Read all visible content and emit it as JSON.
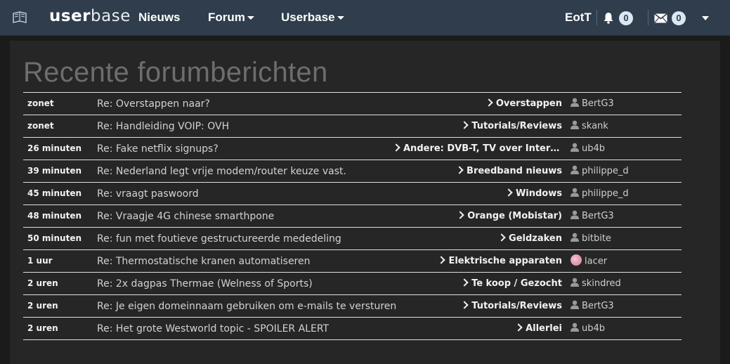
{
  "nav": {
    "brand_bold": "user",
    "brand_light": "base",
    "items": [
      {
        "label": "Nieuws",
        "dropdown": false
      },
      {
        "label": "Forum",
        "dropdown": true
      },
      {
        "label": "Userbase",
        "dropdown": true
      }
    ],
    "username": "EotT",
    "notifications_count": "0",
    "messages_count": "0",
    "icons": [
      "book-icon",
      "bell-icon",
      "envelope-icon",
      "caret-down-icon"
    ]
  },
  "page": {
    "title": "Recente forumberichten"
  },
  "posts": [
    {
      "time": "zonet",
      "title": "Re: Overstappen naar?",
      "forum": "Overstappen",
      "user": "BertG3",
      "avatar": "user-icon"
    },
    {
      "time": "zonet",
      "title": "Re: Handleiding VOIP: OVH",
      "forum": "Tutorials/Reviews",
      "user": "skank",
      "avatar": "user-icon"
    },
    {
      "time": "26 minuten",
      "title": "Re: Fake netflix signups?",
      "forum": "Andere: DVB-T, TV over Interne...",
      "user": "ub4b",
      "avatar": "user-icon"
    },
    {
      "time": "39 minuten",
      "title": "Re: Nederland legt vrije modem/router keuze vast.",
      "forum": "Breedband nieuws",
      "user": "philippe_d",
      "avatar": "user-icon"
    },
    {
      "time": "45 minuten",
      "title": "Re: vraagt paswoord",
      "forum": "Windows",
      "user": "philippe_d",
      "avatar": "user-icon"
    },
    {
      "time": "48 minuten",
      "title": "Re: Vraagje 4G chinese smarthpone",
      "forum": "Orange (Mobistar)",
      "user": "BertG3",
      "avatar": "user-icon"
    },
    {
      "time": "50 minuten",
      "title": "Re: fun met foutieve gestructureerde mededeling",
      "forum": "Geldzaken",
      "user": "bitbite",
      "avatar": "user-icon"
    },
    {
      "time": "1 uur",
      "title": "Re: Thermostatische kranen automatiseren",
      "forum": "Elektrische apparaten",
      "user": "lacer",
      "avatar": "photo-avatar"
    },
    {
      "time": "2 uren",
      "title": "Re: 2x dagpas Thermae (Welness of Sports)",
      "forum": "Te koop / Gezocht",
      "user": "skindred",
      "avatar": "user-icon"
    },
    {
      "time": "2 uren",
      "title": "Re: Je eigen domeinnaam gebruiken om e-mails te versturen",
      "forum": "Tutorials/Reviews",
      "user": "BertG3",
      "avatar": "user-icon"
    },
    {
      "time": "2 uren",
      "title": "Re: Het grote Westworld topic - SPOILER ALERT",
      "forum": "Allerlei",
      "user": "ub4b",
      "avatar": "user-icon"
    }
  ]
}
